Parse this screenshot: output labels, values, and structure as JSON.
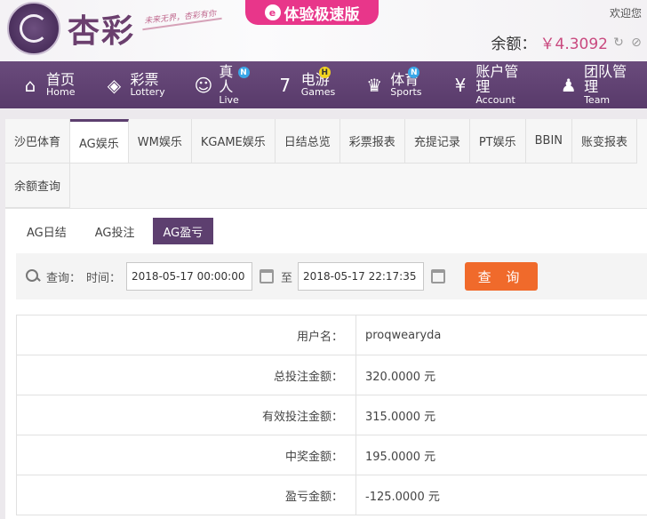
{
  "header": {
    "logo_text": "杏彩",
    "slogan": "未来无界，杏彩有你",
    "speed_label": "体验极速版",
    "welcome": "欢迎您",
    "balance_label": "余额：",
    "balance_amount": "￥4.3092"
  },
  "nav": [
    {
      "cn": "首页",
      "en": "Home",
      "icon": "home-icon"
    },
    {
      "cn": "彩票",
      "en": "Lottery",
      "icon": "ticket-icon"
    },
    {
      "cn": "真人",
      "en": "Live",
      "icon": "dealer-icon",
      "badge": "N"
    },
    {
      "cn": "电游",
      "en": "Games",
      "icon": "seven-icon",
      "badge": "H"
    },
    {
      "cn": "体育",
      "en": "Sports",
      "icon": "trophy-icon",
      "badge": "N"
    },
    {
      "cn": "账户管理",
      "en": "Account",
      "icon": "yen-icon"
    },
    {
      "cn": "团队管理",
      "en": "Team",
      "icon": "team-icon"
    }
  ],
  "subtabs": [
    "沙巴体育",
    "AG娱乐",
    "WM娱乐",
    "KGAME娱乐",
    "日结总览",
    "彩票报表",
    "充提记录",
    "PT娱乐",
    "BBIN",
    "账变报表",
    "余额查询"
  ],
  "active_subtab": "AG娱乐",
  "inner_tabs": [
    "AG日结",
    "AG投注",
    "AG盈亏"
  ],
  "active_inner_tab": "AG盈亏",
  "query": {
    "label": "查询：",
    "time_label": "时间：",
    "start": "2018-05-17 00:00:00",
    "to_label": "至",
    "end": "2018-05-17 22:17:35",
    "button": "查 询"
  },
  "rows": [
    {
      "label": "用户名：",
      "value": "proqwearyda"
    },
    {
      "label": "总投注金额：",
      "value": "320.0000 元"
    },
    {
      "label": "有效投注金额：",
      "value": "315.0000 元"
    },
    {
      "label": "中奖金额：",
      "value": "195.0000 元"
    },
    {
      "label": "盈亏金额：",
      "value": "-125.0000 元"
    }
  ],
  "colors": {
    "accent": "#5d3f6f",
    "pink": "#e8368a",
    "button": "#f06a2b"
  }
}
